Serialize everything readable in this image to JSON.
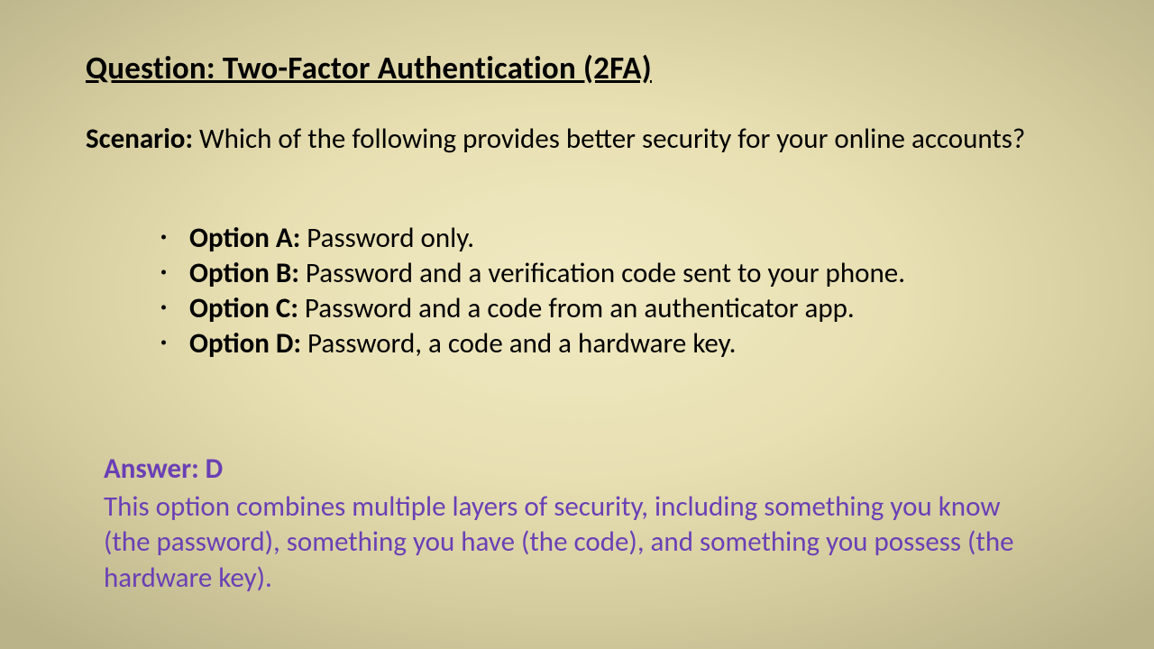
{
  "title": "Question: Two-Factor Authentication (2FA)",
  "scenario": {
    "label": "Scenario:",
    "text": " Which of the following provides better security for your online accounts?"
  },
  "options": [
    {
      "label": "Option A:",
      "text": "  Password only."
    },
    {
      "label": "Option B:",
      "text": "  Password and a verification code sent to your phone."
    },
    {
      "label": "Option C:",
      "text": "  Password and a code from an authenticator app."
    },
    {
      "label": "Option D:",
      "text": "  Password, a code and a hardware key."
    }
  ],
  "answer": {
    "heading": "Answer: D",
    "explanation": "This option combines multiple layers of security, including something you know (the password), something you have (the code), and something you possess (the hardware key)."
  }
}
